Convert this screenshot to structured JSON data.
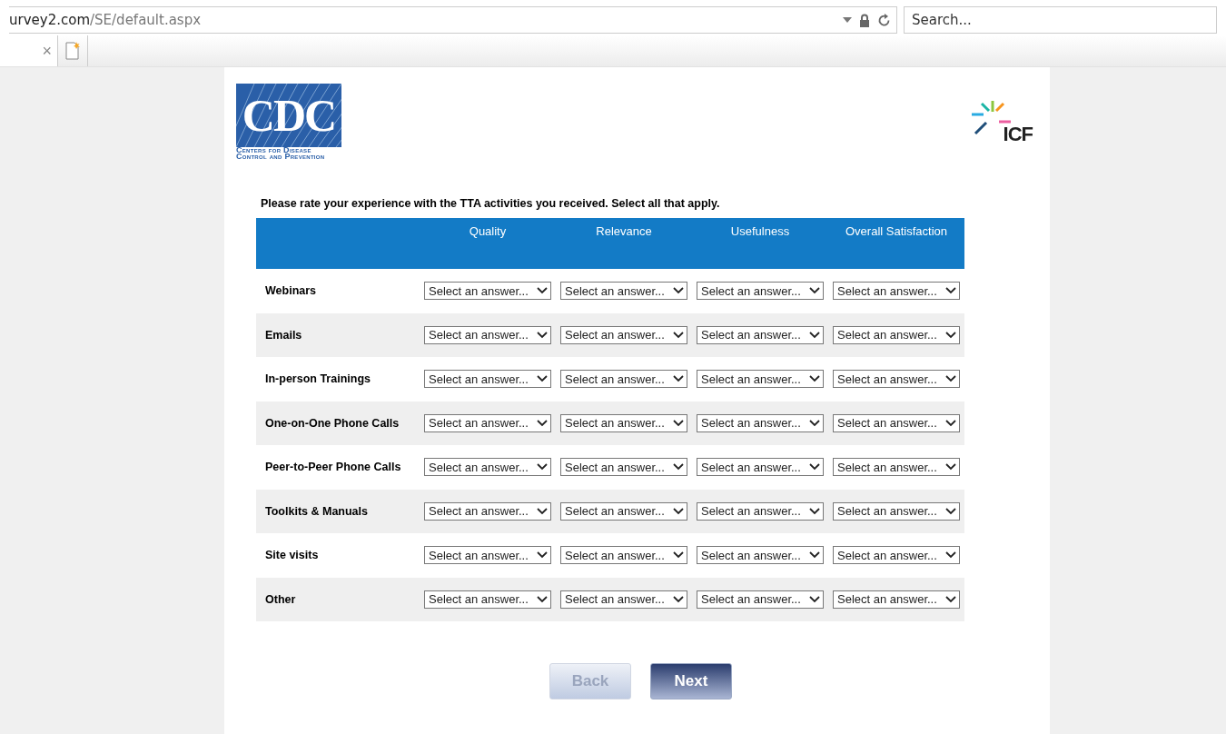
{
  "browser": {
    "url_host": "urvey2.com",
    "url_path": "/SE/default.aspx",
    "search": {
      "placeholder": "Search..."
    },
    "tab_close": "×"
  },
  "header": {
    "cdc_logo": {
      "letters": "CDC",
      "caption_line1": "Centers for Disease",
      "caption_line2": "Control and Prevention"
    },
    "icf_logo": {
      "letters": "ICF"
    }
  },
  "question": "Please rate your experience with the TTA activities you received. Select all that apply.",
  "table": {
    "columns": [
      "Quality",
      "Relevance",
      "Usefulness",
      "Overall Satisfaction"
    ],
    "rows": [
      {
        "label": "Webinars",
        "answers": [
          "Select an answer...",
          "Select an answer...",
          "Select an answer...",
          "Select an answer..."
        ]
      },
      {
        "label": "Emails",
        "answers": [
          "Select an answer...",
          "Select an answer...",
          "Select an answer...",
          "Select an answer..."
        ]
      },
      {
        "label": "In-person Trainings",
        "answers": [
          "Select an answer...",
          "Select an answer...",
          "Select an answer...",
          "Select an answer..."
        ]
      },
      {
        "label": "One-on-One Phone Calls",
        "answers": [
          "Select an answer...",
          "Select an answer...",
          "Select an answer...",
          "Select an answer..."
        ]
      },
      {
        "label": "Peer-to-Peer Phone Calls",
        "answers": [
          "Select an answer...",
          "Select an answer...",
          "Select an answer...",
          "Select an answer..."
        ]
      },
      {
        "label": "Toolkits & Manuals",
        "answers": [
          "Select an answer...",
          "Select an answer...",
          "Select an answer...",
          "Select an answer..."
        ]
      },
      {
        "label": "Site visits",
        "answers": [
          "Select an answer...",
          "Select an answer...",
          "Select an answer...",
          "Select an answer..."
        ]
      },
      {
        "label": "Other",
        "answers": [
          "Select an answer...",
          "Select an answer...",
          "Select an answer...",
          "Select an answer..."
        ]
      }
    ]
  },
  "buttons": [
    {
      "label": "Back",
      "disabled": true
    },
    {
      "label": "Next",
      "disabled": false
    }
  ]
}
